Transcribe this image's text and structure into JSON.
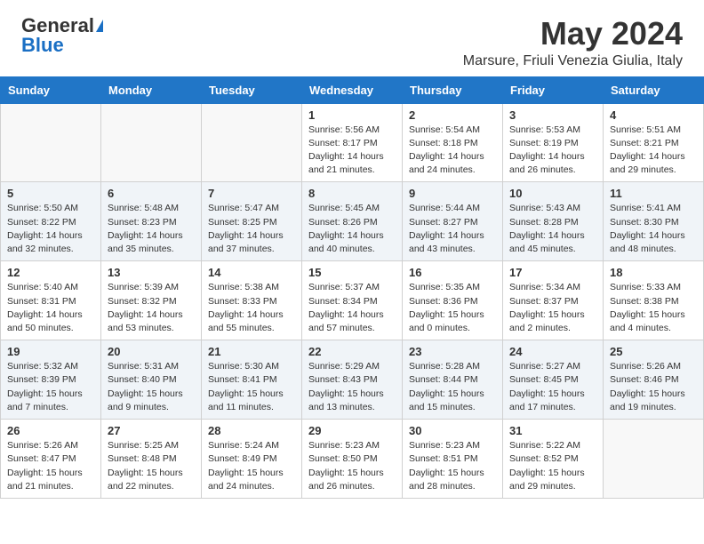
{
  "logo": {
    "general": "General",
    "blue": "Blue"
  },
  "title": "May 2024",
  "location": "Marsure, Friuli Venezia Giulia, Italy",
  "days_of_week": [
    "Sunday",
    "Monday",
    "Tuesday",
    "Wednesday",
    "Thursday",
    "Friday",
    "Saturday"
  ],
  "weeks": [
    [
      {
        "day": "",
        "info": ""
      },
      {
        "day": "",
        "info": ""
      },
      {
        "day": "",
        "info": ""
      },
      {
        "day": "1",
        "info": "Sunrise: 5:56 AM\nSunset: 8:17 PM\nDaylight: 14 hours\nand 21 minutes."
      },
      {
        "day": "2",
        "info": "Sunrise: 5:54 AM\nSunset: 8:18 PM\nDaylight: 14 hours\nand 24 minutes."
      },
      {
        "day": "3",
        "info": "Sunrise: 5:53 AM\nSunset: 8:19 PM\nDaylight: 14 hours\nand 26 minutes."
      },
      {
        "day": "4",
        "info": "Sunrise: 5:51 AM\nSunset: 8:21 PM\nDaylight: 14 hours\nand 29 minutes."
      }
    ],
    [
      {
        "day": "5",
        "info": "Sunrise: 5:50 AM\nSunset: 8:22 PM\nDaylight: 14 hours\nand 32 minutes."
      },
      {
        "day": "6",
        "info": "Sunrise: 5:48 AM\nSunset: 8:23 PM\nDaylight: 14 hours\nand 35 minutes."
      },
      {
        "day": "7",
        "info": "Sunrise: 5:47 AM\nSunset: 8:25 PM\nDaylight: 14 hours\nand 37 minutes."
      },
      {
        "day": "8",
        "info": "Sunrise: 5:45 AM\nSunset: 8:26 PM\nDaylight: 14 hours\nand 40 minutes."
      },
      {
        "day": "9",
        "info": "Sunrise: 5:44 AM\nSunset: 8:27 PM\nDaylight: 14 hours\nand 43 minutes."
      },
      {
        "day": "10",
        "info": "Sunrise: 5:43 AM\nSunset: 8:28 PM\nDaylight: 14 hours\nand 45 minutes."
      },
      {
        "day": "11",
        "info": "Sunrise: 5:41 AM\nSunset: 8:30 PM\nDaylight: 14 hours\nand 48 minutes."
      }
    ],
    [
      {
        "day": "12",
        "info": "Sunrise: 5:40 AM\nSunset: 8:31 PM\nDaylight: 14 hours\nand 50 minutes."
      },
      {
        "day": "13",
        "info": "Sunrise: 5:39 AM\nSunset: 8:32 PM\nDaylight: 14 hours\nand 53 minutes."
      },
      {
        "day": "14",
        "info": "Sunrise: 5:38 AM\nSunset: 8:33 PM\nDaylight: 14 hours\nand 55 minutes."
      },
      {
        "day": "15",
        "info": "Sunrise: 5:37 AM\nSunset: 8:34 PM\nDaylight: 14 hours\nand 57 minutes."
      },
      {
        "day": "16",
        "info": "Sunrise: 5:35 AM\nSunset: 8:36 PM\nDaylight: 15 hours\nand 0 minutes."
      },
      {
        "day": "17",
        "info": "Sunrise: 5:34 AM\nSunset: 8:37 PM\nDaylight: 15 hours\nand 2 minutes."
      },
      {
        "day": "18",
        "info": "Sunrise: 5:33 AM\nSunset: 8:38 PM\nDaylight: 15 hours\nand 4 minutes."
      }
    ],
    [
      {
        "day": "19",
        "info": "Sunrise: 5:32 AM\nSunset: 8:39 PM\nDaylight: 15 hours\nand 7 minutes."
      },
      {
        "day": "20",
        "info": "Sunrise: 5:31 AM\nSunset: 8:40 PM\nDaylight: 15 hours\nand 9 minutes."
      },
      {
        "day": "21",
        "info": "Sunrise: 5:30 AM\nSunset: 8:41 PM\nDaylight: 15 hours\nand 11 minutes."
      },
      {
        "day": "22",
        "info": "Sunrise: 5:29 AM\nSunset: 8:43 PM\nDaylight: 15 hours\nand 13 minutes."
      },
      {
        "day": "23",
        "info": "Sunrise: 5:28 AM\nSunset: 8:44 PM\nDaylight: 15 hours\nand 15 minutes."
      },
      {
        "day": "24",
        "info": "Sunrise: 5:27 AM\nSunset: 8:45 PM\nDaylight: 15 hours\nand 17 minutes."
      },
      {
        "day": "25",
        "info": "Sunrise: 5:26 AM\nSunset: 8:46 PM\nDaylight: 15 hours\nand 19 minutes."
      }
    ],
    [
      {
        "day": "26",
        "info": "Sunrise: 5:26 AM\nSunset: 8:47 PM\nDaylight: 15 hours\nand 21 minutes."
      },
      {
        "day": "27",
        "info": "Sunrise: 5:25 AM\nSunset: 8:48 PM\nDaylight: 15 hours\nand 22 minutes."
      },
      {
        "day": "28",
        "info": "Sunrise: 5:24 AM\nSunset: 8:49 PM\nDaylight: 15 hours\nand 24 minutes."
      },
      {
        "day": "29",
        "info": "Sunrise: 5:23 AM\nSunset: 8:50 PM\nDaylight: 15 hours\nand 26 minutes."
      },
      {
        "day": "30",
        "info": "Sunrise: 5:23 AM\nSunset: 8:51 PM\nDaylight: 15 hours\nand 28 minutes."
      },
      {
        "day": "31",
        "info": "Sunrise: 5:22 AM\nSunset: 8:52 PM\nDaylight: 15 hours\nand 29 minutes."
      },
      {
        "day": "",
        "info": ""
      }
    ]
  ]
}
